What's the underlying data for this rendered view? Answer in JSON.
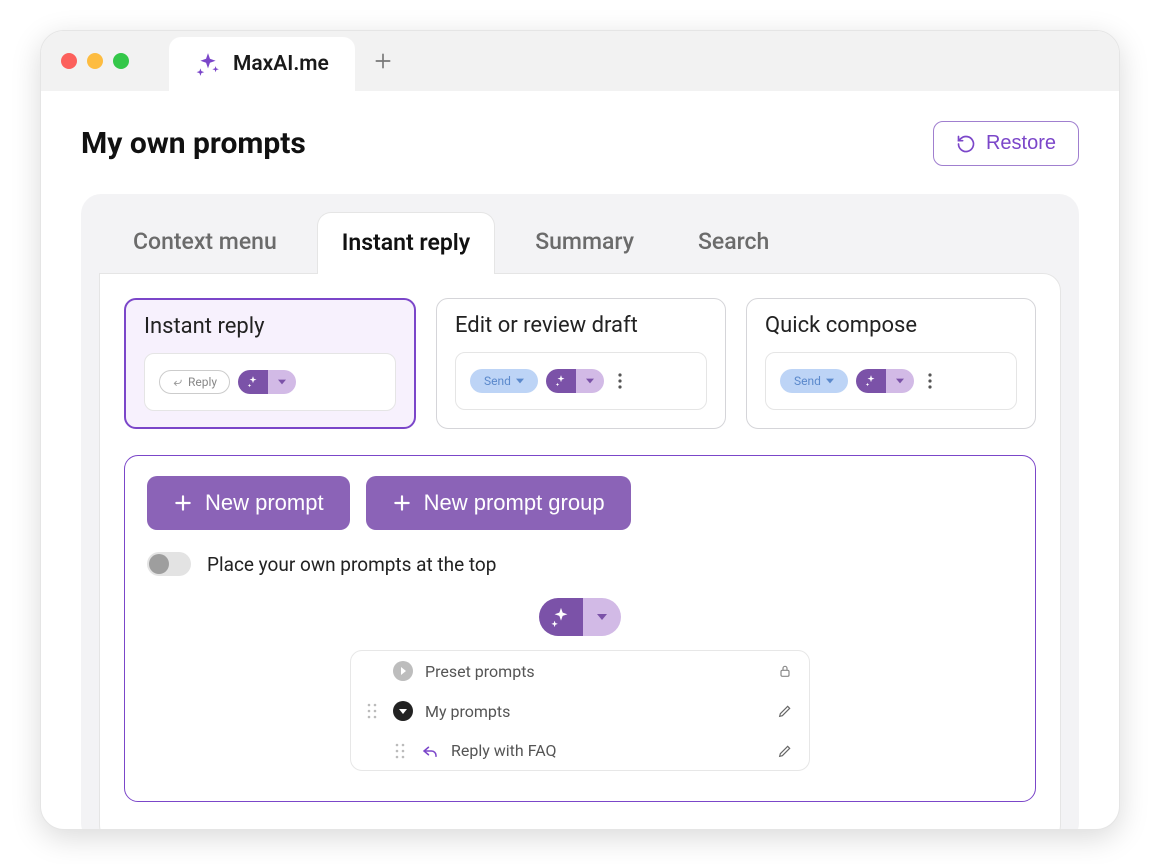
{
  "colors": {
    "accent": "#7b46c9",
    "accent_medium": "#8b63b7",
    "accent_light": "#d2bae6",
    "accent_dark": "#7b52a8"
  },
  "browser": {
    "tab_title": "MaxAI.me"
  },
  "header": {
    "title": "My own prompts",
    "restore_label": "Restore"
  },
  "tabs": [
    {
      "id": "context",
      "label": "Context menu",
      "active": false
    },
    {
      "id": "instant",
      "label": "Instant reply",
      "active": true
    },
    {
      "id": "summary",
      "label": "Summary",
      "active": false
    },
    {
      "id": "search",
      "label": "Search",
      "active": false
    }
  ],
  "cards": [
    {
      "id": "instant",
      "title": "Instant reply",
      "selected": true,
      "chip_label": "Reply",
      "chip_style": "outline",
      "kebab": false
    },
    {
      "id": "edit",
      "title": "Edit or review draft",
      "selected": false,
      "chip_label": "Send",
      "chip_style": "blue",
      "kebab": true
    },
    {
      "id": "compose",
      "title": "Quick compose",
      "selected": false,
      "chip_label": "Send",
      "chip_style": "blue",
      "kebab": true
    }
  ],
  "editor": {
    "new_prompt_label": "New prompt",
    "new_group_label": "New prompt group",
    "toggle_label": "Place your own prompts at the top",
    "toggle_on": false,
    "list": {
      "preset_label": "Preset prompts",
      "my_prompts_label": "My prompts",
      "child_label": "Reply with FAQ"
    }
  }
}
